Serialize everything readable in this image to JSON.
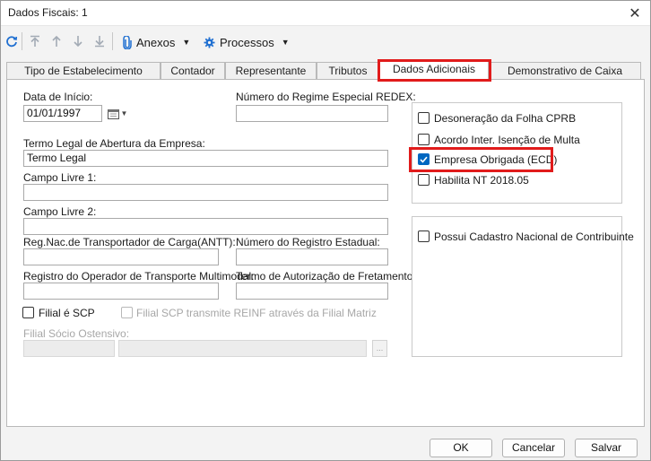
{
  "window": {
    "title": "Dados Fiscais: 1",
    "close_glyph": "✕"
  },
  "toolbar": {
    "icons": [
      "refresh-icon",
      "move-first-icon",
      "move-up-icon",
      "move-down-icon",
      "move-last-icon"
    ],
    "anexos_label": "Anexos",
    "processos_label": "Processos"
  },
  "tabs": [
    {
      "label": "Tipo de Estabelecimento"
    },
    {
      "label": "Contador"
    },
    {
      "label": "Representante"
    },
    {
      "label": "Tributos"
    },
    {
      "label": "Dados Adicionais",
      "active": true
    },
    {
      "label": "Demonstrativo de Caixa"
    }
  ],
  "form": {
    "data_inicio_label": "Data de Início:",
    "data_inicio_value": "01/01/1997",
    "redex_label": "Número do Regime Especial REDEX:",
    "redex_value": "",
    "termo_legal_label": "Termo Legal de Abertura da Empresa:",
    "termo_legal_value": "Termo Legal",
    "campo_livre1_label": "Campo Livre 1:",
    "campo_livre2_label": "Campo Livre 2:",
    "antt_label": "Reg.Nac.de Transportador de Carga(ANTT):",
    "registro_estadual_label": "Número do Registro Estadual:",
    "multimodal_label": "Registro do Operador de Transporte Multimodal:",
    "fretamento_label": "Termo de Autorização de Fretamento:",
    "filial_scp_label": "Filial é SCP",
    "filial_scp_reinf_label": "Filial SCP transmite REINF através da Filial Matriz",
    "filial_socio_label": "Filial Sócio Ostensivo:",
    "ellipsis_label": "..."
  },
  "options": {
    "desoneracao_label": "Desoneração da Folha CPRB",
    "acordo_label": "Acordo Inter. Isenção de Multa",
    "ecd_label": "Empresa Obrigada (ECD)",
    "ecd_checked": true,
    "habilita_label": "Habilita NT 2018.05",
    "cadastro_label": "Possui Cadastro Nacional de Contribuinte"
  },
  "footer": {
    "ok_label": "OK",
    "cancelar_label": "Cancelar",
    "salvar_label": "Salvar"
  },
  "colors": {
    "highlight": "#e11b1b",
    "check_accent": "#0067c0",
    "toolbar_icon": "#1f6fd1"
  }
}
